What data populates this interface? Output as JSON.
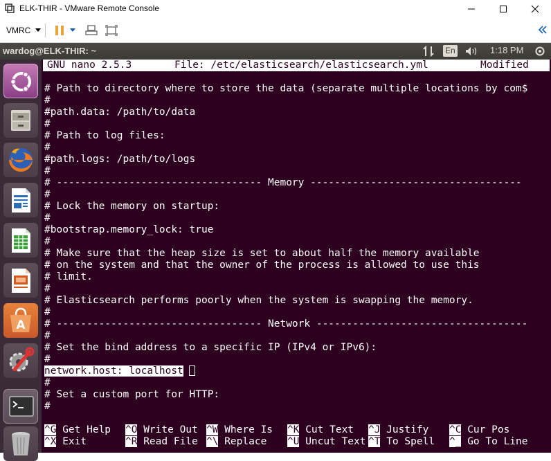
{
  "window": {
    "title": "ELK-THIR - VMware Remote Console",
    "controls": [
      "minimize",
      "maximize",
      "close"
    ]
  },
  "toolbar": {
    "vmrc_menu": "VMRC",
    "icons": [
      "pause-icon",
      "send-ctrl-alt-del-icon",
      "fullscreen-icon",
      "collapse-icon"
    ]
  },
  "panel": {
    "terminal_title": "wardog@ELK-THIR: ~",
    "keyboard_layout": "En",
    "clock": "1:18 PM"
  },
  "launcher": {
    "items": [
      "ubuntu-dash-icon",
      "files-icon",
      "firefox-icon",
      "writer-icon",
      "calc-icon",
      "impress-icon",
      "software-center-icon",
      "system-settings-icon",
      "terminal-icon",
      "trash-icon"
    ]
  },
  "nano": {
    "version": "GNU nano 2.5.3",
    "file": "File: /etc/elasticsearch/elasticsearch.yml",
    "status": "Modified"
  },
  "lines": [
    "",
    "# Path to directory where to store the data (separate multiple locations by com$",
    "#",
    "#path.data: /path/to/data",
    "#",
    "# Path to log files:",
    "#",
    "#path.logs: /path/to/logs",
    "#",
    "# ---------------------------------- Memory -----------------------------------",
    "#",
    "# Lock the memory on startup:",
    "#",
    "#bootstrap.memory_lock: true",
    "#",
    "# Make sure that the heap size is set to about half the memory available",
    "# on the system and that the owner of the process is allowed to use this",
    "# limit.",
    "#",
    "# Elasticsearch performs poorly when the system is swapping the memory.",
    "#",
    "# ---------------------------------- Network -----------------------------------",
    "#",
    "# Set the bind address to a specific IP (IPv4 or IPv6):",
    "#",
    "network.host: localhost",
    "#",
    "# Set a custom port for HTTP:",
    "#"
  ],
  "shortcuts": {
    "row1": [
      {
        "key": "^G",
        "label": " Get Help"
      },
      {
        "key": "^O",
        "label": " Write Out"
      },
      {
        "key": "^W",
        "label": " Where Is"
      },
      {
        "key": "^K",
        "label": " Cut Text"
      },
      {
        "key": "^J",
        "label": " Justify"
      },
      {
        "key": "^C",
        "label": " Cur Pos"
      }
    ],
    "row2": [
      {
        "key": "^X",
        "label": " Exit"
      },
      {
        "key": "^R",
        "label": " Read File"
      },
      {
        "key": "^\\",
        "label": " Replace"
      },
      {
        "key": "^U",
        "label": " Uncut Text"
      },
      {
        "key": "^T",
        "label": " To Spell"
      },
      {
        "key": "^_",
        "label": " Go To Line"
      }
    ]
  },
  "colors": {
    "terminal_bg": "#2c001e",
    "terminal_fg": "#ffffff",
    "launcher_bg": "#3b2b38",
    "panel_bg": "#3c3b37"
  }
}
